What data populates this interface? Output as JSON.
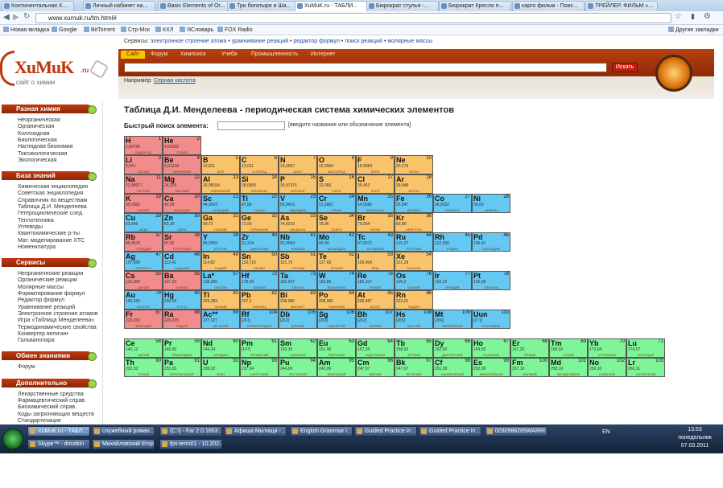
{
  "browser": {
    "tabs": [
      {
        "label": "Континентальная Х..."
      },
      {
        "label": "Личный кабинет на..."
      },
      {
        "label": "Basic Elements of Or..."
      },
      {
        "label": "Три богатыря и Ша..."
      },
      {
        "label": "XuMuK.ru - ТАБЛИ..."
      },
      {
        "label": "Бюрократ стулья -..."
      },
      {
        "label": "Бюрократ Кресло п..."
      },
      {
        "label": "карго фильм - Поис..."
      },
      {
        "label": "ТРЕЙЛЕР. ФИЛЬМ «..."
      }
    ],
    "url": "www.xumuk.ru/tm.html#",
    "bookmarks": [
      "Новая вкладка",
      "Google",
      "BitTorrent",
      "Стр-Мск",
      "КХЛ",
      "ЯСловарь",
      "FOX Radio"
    ],
    "other_bookmarks": "Другие закладки"
  },
  "site": {
    "logo": "XuMuK",
    "logo_suffix": ".ru",
    "logo_sub": "сайт о химии",
    "services_label": "Сервисы:",
    "services": [
      "электронное строение атома",
      "уравнивание реакций",
      "редактор формул",
      "поиск реакций",
      "молярные массы"
    ],
    "menu": [
      "Сайт",
      "Форум",
      "Химпоиск",
      "Учеба",
      "Промышленность",
      "Интернет"
    ],
    "search_button": "Искать",
    "example_label": "Например:",
    "example_link": "Серная кислота"
  },
  "sidebar": [
    {
      "title": "Разная химия",
      "items": [
        "Неорганическая",
        "Органическая",
        "Коллоидная",
        "Биологическая",
        "Наглядная биохимия",
        "Токсикологическая",
        "Экологическая"
      ]
    },
    {
      "title": "База знаний",
      "items": [
        "Химическая энциклопедия",
        "Советская энциклопедия",
        "Справочник по веществам",
        "Таблица Д.И. Менделеева",
        "Гетероциклические соед.",
        "Теплотехника",
        "Углеводы",
        "Квантохимические р-ты",
        "Мат. моделирование ХТС",
        "Номенклатура"
      ]
    },
    {
      "title": "Сервисы",
      "items": [
        "Неорганические реакции",
        "Органические реакции",
        "Молярные массы",
        "Форматирование формул",
        "Редактор формул",
        "Уравнивание реакций",
        "Электронное строение атомов",
        "Игра «Таблица Менделеева»",
        "Термодинамические свойства",
        "Конвертер величин",
        "Гальванопара"
      ]
    },
    {
      "title": "Обмен знаниями",
      "items": [
        "Форум"
      ]
    },
    {
      "title": "Дополнительно",
      "items": [
        "Лекарственные средства",
        "Фармацевтический справ.",
        "Биохимический справ.",
        "Коды загрязняющих веществ",
        "Стандартизация"
      ]
    }
  ],
  "main": {
    "title": "Таблица Д.И. Менделеева - периодическая система химических элементов",
    "quick_search_label": "Быстрый поиск элемента:",
    "quick_search_hint": "[введите название или обозначение элемента]"
  },
  "category_colors": {
    "s": "#f28b8b",
    "p": "#f8c36a",
    "d": "#65c8f2",
    "f": "#7ef598"
  },
  "elements": [
    {
      "s": "H",
      "z": "1",
      "m": "1,00794",
      "n": "ВОДОРОД",
      "c": "s",
      "col": 1,
      "row": 1
    },
    {
      "s": "He",
      "z": "2",
      "m": "4,00260",
      "n": "ГЕЛИЙ",
      "c": "s",
      "col": 2,
      "row": 1
    },
    {
      "s": "Li",
      "z": "3",
      "m": "6,941",
      "n": "ЛИТИЙ",
      "c": "s",
      "col": 1,
      "row": 2
    },
    {
      "s": "Be",
      "z": "4",
      "m": "9,01218",
      "n": "БЕРИЛЛИЙ",
      "c": "s",
      "col": 2,
      "row": 2
    },
    {
      "s": "B",
      "z": "5",
      "m": "10,811",
      "n": "БОР",
      "c": "p",
      "col": 3,
      "row": 2
    },
    {
      "s": "C",
      "z": "6",
      "m": "12,011",
      "n": "УГЛЕРОД",
      "c": "p",
      "col": 4,
      "row": 2
    },
    {
      "s": "N",
      "z": "7",
      "m": "14,0067",
      "n": "АЗОТ",
      "c": "p",
      "col": 5,
      "row": 2
    },
    {
      "s": "O",
      "z": "8",
      "m": "15,9994",
      "n": "КИСЛОРОД",
      "c": "p",
      "col": 6,
      "row": 2
    },
    {
      "s": "F",
      "z": "9",
      "m": "18,9984",
      "n": "ФТОР",
      "c": "p",
      "col": 7,
      "row": 2
    },
    {
      "s": "Ne",
      "z": "10",
      "m": "20,179",
      "n": "НЕОН",
      "c": "p",
      "col": 8,
      "row": 2
    },
    {
      "s": "Na",
      "z": "11",
      "m": "22,98977",
      "n": "НАТРИЙ",
      "c": "s",
      "col": 1,
      "row": 3
    },
    {
      "s": "Mg",
      "z": "12",
      "m": "24,305",
      "n": "МАГНИЙ",
      "c": "s",
      "col": 2,
      "row": 3
    },
    {
      "s": "Al",
      "z": "13",
      "m": "26,98154",
      "n": "АЛЮМИНИЙ",
      "c": "p",
      "col": 3,
      "row": 3
    },
    {
      "s": "Si",
      "z": "14",
      "m": "28,0855",
      "n": "КРЕМНИЙ",
      "c": "p",
      "col": 4,
      "row": 3
    },
    {
      "s": "P",
      "z": "15",
      "m": "30,97376",
      "n": "ФОСФОР",
      "c": "p",
      "col": 5,
      "row": 3
    },
    {
      "s": "S",
      "z": "16",
      "m": "32,066",
      "n": "СЕРА",
      "c": "p",
      "col": 6,
      "row": 3
    },
    {
      "s": "Cl",
      "z": "17",
      "m": "35,453",
      "n": "ХЛОР",
      "c": "p",
      "col": 7,
      "row": 3
    },
    {
      "s": "Ar",
      "z": "18",
      "m": "39,948",
      "n": "АРГОН",
      "c": "p",
      "col": 8,
      "row": 3
    },
    {
      "s": "K",
      "z": "19",
      "m": "39,0983",
      "n": "КАЛИЙ",
      "c": "s",
      "col": 1,
      "row": 4
    },
    {
      "s": "Ca",
      "z": "20",
      "m": "40,08",
      "n": "КАЛЬЦИЙ",
      "c": "s",
      "col": 2,
      "row": 4
    },
    {
      "s": "Sc",
      "z": "21",
      "m": "44,9559",
      "n": "СКАНДИЙ",
      "c": "d",
      "col": 3,
      "row": 4
    },
    {
      "s": "Ti",
      "z": "22",
      "m": "47,88",
      "n": "ТИТАН",
      "c": "d",
      "col": 4,
      "row": 4
    },
    {
      "s": "V",
      "z": "23",
      "m": "50,9415",
      "n": "ВАНАДИЙ",
      "c": "d",
      "col": 5,
      "row": 4
    },
    {
      "s": "Cr",
      "z": "24",
      "m": "51,9961",
      "n": "ХРОМ",
      "c": "d",
      "col": 6,
      "row": 4
    },
    {
      "s": "Mn",
      "z": "25",
      "m": "54,9380",
      "n": "МАРГАНЕЦ",
      "c": "d",
      "col": 7,
      "row": 4
    },
    {
      "s": "Fe",
      "z": "26",
      "m": "55,847",
      "n": "ЖЕЛЕЗО",
      "c": "d",
      "col": 8,
      "row": 4
    },
    {
      "s": "Co",
      "z": "27",
      "m": "58,9332",
      "n": "КОБАЛЬТ",
      "c": "d",
      "col": 9,
      "row": 4
    },
    {
      "s": "Ni",
      "z": "28",
      "m": "58,69",
      "n": "НИКЕЛЬ",
      "c": "d",
      "col": 10,
      "row": 4
    },
    {
      "s": "Cu",
      "z": "29",
      "m": "63,546",
      "n": "МЕДЬ",
      "c": "d",
      "col": 1,
      "row": 5
    },
    {
      "s": "Zn",
      "z": "30",
      "m": "65,39",
      "n": "ЦИНК",
      "c": "d",
      "col": 2,
      "row": 5
    },
    {
      "s": "Ga",
      "z": "31",
      "m": "69,72",
      "n": "ГАЛЛИЙ",
      "c": "p",
      "col": 3,
      "row": 5
    },
    {
      "s": "Ge",
      "z": "32",
      "m": "72,59",
      "n": "ГЕРМАНИЙ",
      "c": "p",
      "col": 4,
      "row": 5
    },
    {
      "s": "As",
      "z": "33",
      "m": "74,9216",
      "n": "МЫШЬЯК",
      "c": "p",
      "col": 5,
      "row": 5
    },
    {
      "s": "Se",
      "z": "34",
      "m": "78,96",
      "n": "СЕЛЕН",
      "c": "p",
      "col": 6,
      "row": 5
    },
    {
      "s": "Br",
      "z": "35",
      "m": "79,904",
      "n": "БРОМ",
      "c": "p",
      "col": 7,
      "row": 5
    },
    {
      "s": "Kr",
      "z": "36",
      "m": "83,80",
      "n": "КРИПТОН",
      "c": "p",
      "col": 8,
      "row": 5
    },
    {
      "s": "Rb",
      "z": "37",
      "m": "85,4678",
      "n": "РУБИДИЙ",
      "c": "s",
      "col": 1,
      "row": 6
    },
    {
      "s": "Sr",
      "z": "38",
      "m": "87,62",
      "n": "СТРОНЦИЙ",
      "c": "s",
      "col": 2,
      "row": 6
    },
    {
      "s": "Y",
      "z": "39",
      "m": "88,9059",
      "n": "ИТТРИЙ",
      "c": "d",
      "col": 3,
      "row": 6
    },
    {
      "s": "Zr",
      "z": "40",
      "m": "91,224",
      "n": "ЦИРКОНИЙ",
      "c": "d",
      "col": 4,
      "row": 6
    },
    {
      "s": "Nb",
      "z": "41",
      "m": "92,9064",
      "n": "НИОБИЙ",
      "c": "d",
      "col": 5,
      "row": 6
    },
    {
      "s": "Mo",
      "z": "42",
      "m": "95,94",
      "n": "МОЛИБДЕН",
      "c": "d",
      "col": 6,
      "row": 6
    },
    {
      "s": "Tc",
      "z": "43",
      "m": "97,9072",
      "n": "ТЕХНЕЦИЙ",
      "c": "d",
      "col": 7,
      "row": 6
    },
    {
      "s": "Ru",
      "z": "44",
      "m": "101,07",
      "n": "РУТЕНИЙ",
      "c": "d",
      "col": 8,
      "row": 6
    },
    {
      "s": "Rh",
      "z": "45",
      "m": "102,906",
      "n": "РОДИЙ",
      "c": "d",
      "col": 9,
      "row": 6
    },
    {
      "s": "Pd",
      "z": "46",
      "m": "106,42",
      "n": "ПАЛЛАДИЙ",
      "c": "d",
      "col": 10,
      "row": 6
    },
    {
      "s": "Ag",
      "z": "47",
      "m": "107,868",
      "n": "СЕРЕБРО",
      "c": "d",
      "col": 1,
      "row": 7
    },
    {
      "s": "Cd",
      "z": "48",
      "m": "112,41",
      "n": "КАДМИЙ",
      "c": "d",
      "col": 2,
      "row": 7
    },
    {
      "s": "In",
      "z": "49",
      "m": "114,82",
      "n": "ИНДИЙ",
      "c": "p",
      "col": 3,
      "row": 7
    },
    {
      "s": "Sn",
      "z": "50",
      "m": "118,710",
      "n": "ОЛОВО",
      "c": "p",
      "col": 4,
      "row": 7
    },
    {
      "s": "Sb",
      "z": "51",
      "m": "121,75",
      "n": "СУРЬМА",
      "c": "p",
      "col": 5,
      "row": 7
    },
    {
      "s": "Te",
      "z": "52",
      "m": "127,60",
      "n": "ТЕЛЛУР",
      "c": "p",
      "col": 6,
      "row": 7
    },
    {
      "s": "I",
      "z": "53",
      "m": "126,904",
      "n": "ЙОД",
      "c": "p",
      "col": 7,
      "row": 7
    },
    {
      "s": "Xe",
      "z": "54",
      "m": "131,29",
      "n": "КСЕНОН",
      "c": "p",
      "col": 8,
      "row": 7
    },
    {
      "s": "Cs",
      "z": "55",
      "m": "132,905",
      "n": "ЦЕЗИЙ",
      "c": "s",
      "col": 1,
      "row": 8
    },
    {
      "s": "Ba",
      "z": "56",
      "m": "137,33",
      "n": "БАРИЙ",
      "c": "s",
      "col": 2,
      "row": 8
    },
    {
      "s": "La*",
      "z": "57",
      "m": "138,905",
      "n": "ЛАНТАН",
      "c": "d",
      "col": 3,
      "row": 8
    },
    {
      "s": "Hf",
      "z": "72",
      "m": "178,49",
      "n": "ГАФНИЙ",
      "c": "d",
      "col": 4,
      "row": 8
    },
    {
      "s": "Ta",
      "z": "73",
      "m": "180,947",
      "n": "ТАНТАЛ",
      "c": "d",
      "col": 5,
      "row": 8
    },
    {
      "s": "W",
      "z": "74",
      "m": "183,85",
      "n": "ВОЛЬФРАМ",
      "c": "d",
      "col": 6,
      "row": 8
    },
    {
      "s": "Re",
      "z": "75",
      "m": "186,207",
      "n": "РЕНИЙ",
      "c": "d",
      "col": 7,
      "row": 8
    },
    {
      "s": "Os",
      "z": "76",
      "m": "190,2",
      "n": "ОСМИЙ",
      "c": "d",
      "col": 8,
      "row": 8
    },
    {
      "s": "Ir",
      "z": "77",
      "m": "192,22",
      "n": "ИРИДИЙ",
      "c": "d",
      "col": 9,
      "row": 8
    },
    {
      "s": "Pt",
      "z": "78",
      "m": "195,08",
      "n": "ПЛАТИНА",
      "c": "d",
      "col": 10,
      "row": 8
    },
    {
      "s": "Au",
      "z": "79",
      "m": "196,966",
      "n": "ЗОЛОТО",
      "c": "d",
      "col": 1,
      "row": 9
    },
    {
      "s": "Hg",
      "z": "80",
      "m": "200,59",
      "n": "РТУТЬ",
      "c": "d",
      "col": 2,
      "row": 9
    },
    {
      "s": "Tl",
      "z": "81",
      "m": "204,383",
      "n": "ТАЛЛИЙ",
      "c": "p",
      "col": 3,
      "row": 9
    },
    {
      "s": "Pb",
      "z": "82",
      "m": "207,2",
      "n": "СВИНЕЦ",
      "c": "p",
      "col": 4,
      "row": 9
    },
    {
      "s": "Bi",
      "z": "83",
      "m": "208,980",
      "n": "ВИСМУТ",
      "c": "p",
      "col": 5,
      "row": 9
    },
    {
      "s": "Po",
      "z": "84",
      "m": "208,982",
      "n": "ПОЛОНИЙ",
      "c": "p",
      "col": 6,
      "row": 9
    },
    {
      "s": "At",
      "z": "85",
      "m": "209,987",
      "n": "АСТАТ",
      "c": "p",
      "col": 7,
      "row": 9
    },
    {
      "s": "Rn",
      "z": "86",
      "m": "222,01",
      "n": "РАДОН",
      "c": "p",
      "col": 8,
      "row": 9
    },
    {
      "s": "Fr",
      "z": "87",
      "m": "223,019",
      "n": "ФРАНЦИЙ",
      "c": "s",
      "col": 1,
      "row": 10
    },
    {
      "s": "Ra",
      "z": "88",
      "m": "226,025",
      "n": "РАДИЙ",
      "c": "s",
      "col": 2,
      "row": 10
    },
    {
      "s": "Ac**",
      "z": "89",
      "m": "227,027",
      "n": "АКТИНИЙ",
      "c": "d",
      "col": 3,
      "row": 10
    },
    {
      "s": "Rf",
      "z": "104",
      "m": "[261]",
      "n": "РЕЗЕРФОРДИЙ",
      "c": "d",
      "col": 4,
      "row": 10
    },
    {
      "s": "Db",
      "z": "105",
      "m": "[262]",
      "n": "ДУБНИЙ",
      "c": "d",
      "col": 5,
      "row": 10
    },
    {
      "s": "Sg",
      "z": "106",
      "m": "[263]",
      "n": "СИБОРГИЙ",
      "c": "d",
      "col": 6,
      "row": 10
    },
    {
      "s": "Bh",
      "z": "107",
      "m": "[262]",
      "n": "БОРИЙ",
      "c": "d",
      "col": 7,
      "row": 10
    },
    {
      "s": "Hs",
      "z": "108",
      "m": "[265]",
      "n": "ХАССИЙ",
      "c": "d",
      "col": 8,
      "row": 10
    },
    {
      "s": "Mt",
      "z": "109",
      "m": "[266]",
      "n": "МЕЙТНЕРИЙ",
      "c": "d",
      "col": 9,
      "row": 10
    },
    {
      "s": "Uun",
      "z": "110",
      "m": "[271]",
      "n": "УНУНИЛИЙ",
      "c": "d",
      "col": 10,
      "row": 10
    },
    {
      "s": "Ce",
      "z": "58",
      "m": "140,12",
      "n": "ЦЕРИЙ",
      "c": "f",
      "col": 1,
      "row": 12
    },
    {
      "s": "Pr",
      "z": "59",
      "m": "140,90",
      "n": "ПРАЗЕОДИМ",
      "c": "f",
      "col": 2,
      "row": 12
    },
    {
      "s": "Nd",
      "z": "60",
      "m": "144,24",
      "n": "НЕОДИМ",
      "c": "f",
      "col": 3,
      "row": 12
    },
    {
      "s": "Pm",
      "z": "61",
      "m": "[147]",
      "n": "ПРОМЕТИЙ",
      "c": "f",
      "col": 4,
      "row": 12
    },
    {
      "s": "Sm",
      "z": "62",
      "m": "150,36",
      "n": "САМАРИЙ",
      "c": "f",
      "col": 5,
      "row": 12
    },
    {
      "s": "Eu",
      "z": "63",
      "m": "151,96",
      "n": "ЕВРОПИЙ",
      "c": "f",
      "col": 6,
      "row": 12
    },
    {
      "s": "Gd",
      "z": "64",
      "m": "157,25",
      "n": "ГАДОЛИНИЙ",
      "c": "f",
      "col": 7,
      "row": 12
    },
    {
      "s": "Tb",
      "z": "65",
      "m": "158,93",
      "n": "ТЕРБИЙ",
      "c": "f",
      "col": 8,
      "row": 12
    },
    {
      "s": "Dy",
      "z": "66",
      "m": "162,50",
      "n": "ДИСПРОЗИЙ",
      "c": "f",
      "col": 9,
      "row": 12
    },
    {
      "s": "Ho",
      "z": "67",
      "m": "164,93",
      "n": "ГОЛЬМИЙ",
      "c": "f",
      "col": 10,
      "row": 12
    },
    {
      "s": "Er",
      "z": "68",
      "m": "167,26",
      "n": "ЭРБИЙ",
      "c": "f",
      "col": 11,
      "row": 12
    },
    {
      "s": "Tm",
      "z": "69",
      "m": "168,93",
      "n": "ТУЛИЙ",
      "c": "f",
      "col": 12,
      "row": 12
    },
    {
      "s": "Yb",
      "z": "70",
      "m": "173,04",
      "n": "ИТТЕРБИЙ",
      "c": "f",
      "col": 13,
      "row": 12
    },
    {
      "s": "Lu",
      "z": "71",
      "m": "174,97",
      "n": "ЛЮТЕЦИЙ",
      "c": "f",
      "col": 14,
      "row": 12
    },
    {
      "s": "Th",
      "z": "90",
      "m": "232,03",
      "n": "ТОРИЙ",
      "c": "f",
      "col": 1,
      "row": 13
    },
    {
      "s": "Pa",
      "z": "91",
      "m": "231,03",
      "n": "ПРОТАКТИНИЙ",
      "c": "f",
      "col": 2,
      "row": 13
    },
    {
      "s": "U",
      "z": "92",
      "m": "238,02",
      "n": "УРАН",
      "c": "f",
      "col": 3,
      "row": 13
    },
    {
      "s": "Np",
      "z": "93",
      "m": "237,04",
      "n": "НЕПТУНИЙ",
      "c": "f",
      "col": 4,
      "row": 13
    },
    {
      "s": "Pu",
      "z": "94",
      "m": "244,06",
      "n": "ПЛУТОНИЙ",
      "c": "f",
      "col": 5,
      "row": 13
    },
    {
      "s": "Am",
      "z": "95",
      "m": "243,06",
      "n": "АМЕРИЦИЙ",
      "c": "f",
      "col": 6,
      "row": 13
    },
    {
      "s": "Cm",
      "z": "96",
      "m": "247,07",
      "n": "КЮРИЙ",
      "c": "f",
      "col": 7,
      "row": 13
    },
    {
      "s": "Bk",
      "z": "97",
      "m": "247,07",
      "n": "БЕРКЛИЙ",
      "c": "f",
      "col": 8,
      "row": 13
    },
    {
      "s": "Cf",
      "z": "98",
      "m": "251,08",
      "n": "КАЛИФОРНИЙ",
      "c": "f",
      "col": 9,
      "row": 13
    },
    {
      "s": "Es",
      "z": "99",
      "m": "252,08",
      "n": "ЭЙНШТЕЙНИЙ",
      "c": "f",
      "col": 10,
      "row": 13
    },
    {
      "s": "Fm",
      "z": "100",
      "m": "257,10",
      "n": "ФЕРМИЙ",
      "c": "f",
      "col": 11,
      "row": 13
    },
    {
      "s": "Md",
      "z": "101",
      "m": "258,10",
      "n": "МЕНДЕЛЕВИЙ",
      "c": "f",
      "col": 12,
      "row": 13
    },
    {
      "s": "No",
      "z": "102",
      "m": "259,10",
      "n": "НОБЕЛИЙ",
      "c": "f",
      "col": 13,
      "row": 13
    },
    {
      "s": "Lr",
      "z": "103",
      "m": "260,11",
      "n": "ЛОУРЕНСИЙ",
      "c": "f",
      "col": 14,
      "row": 13
    }
  ],
  "taskbar": {
    "row1": [
      "XuMuK.ru - ТАБЛ...",
      "служебный роман...",
      "{C:\\} - Far 2.0.1653 ...",
      "Афиша Мытищи - ...",
      "English Grammar i...",
      "Guided Practice in ...",
      "Guided Practice in ...",
      "0030986265WARRI..."
    ],
    "row2": [
      "Skype™ - dmotkin",
      "Михайловский Егор",
      "fps-term01 - 10.202.4..."
    ],
    "lang": "EN",
    "time": "13:53",
    "weekday": "понедельник",
    "date": "07.03.2011"
  }
}
